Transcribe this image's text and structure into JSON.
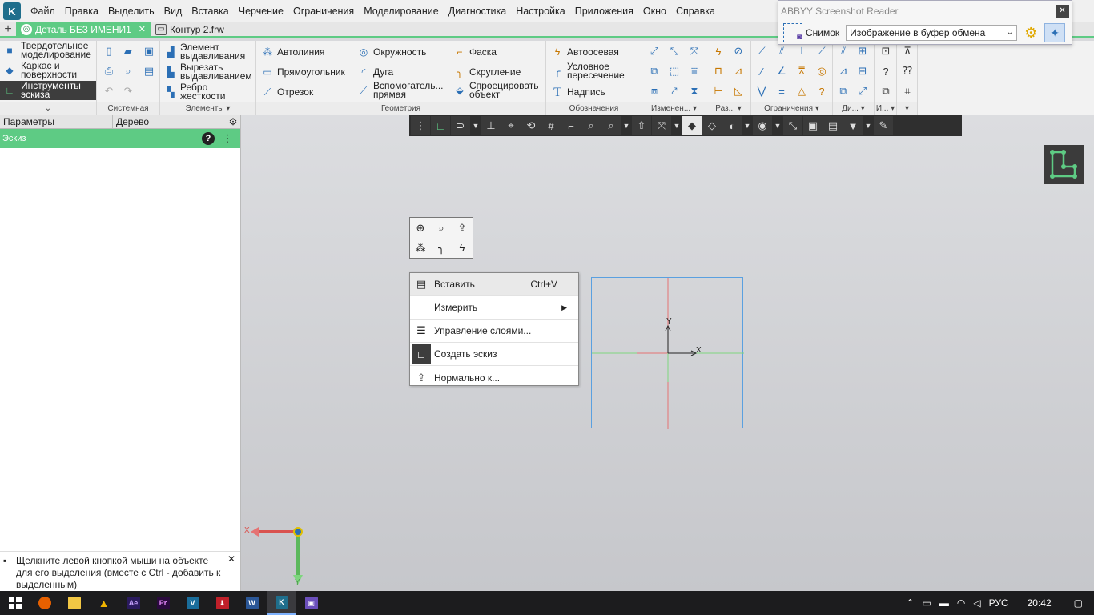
{
  "menu": [
    "Файл",
    "Правка",
    "Выделить",
    "Вид",
    "Вставка",
    "Черчение",
    "Ограничения",
    "Моделирование",
    "Диагностика",
    "Настройка",
    "Приложения",
    "Окно",
    "Справка"
  ],
  "tabs": [
    {
      "label": "Деталь БЕЗ ИМЕНИ1",
      "active": true
    },
    {
      "label": "Контур 2.frw",
      "active": false
    }
  ],
  "ribbon": {
    "modes": [
      "Твердотельное моделирование",
      "Каркас и поверхности",
      "Инструменты эскиза"
    ],
    "system_caption": "Системная",
    "elements": [
      "Элемент выдавливания",
      "Вырезать выдавливанием",
      "Ребро жесткости"
    ],
    "elements_caption": "Элементы",
    "geometry": {
      "col1": [
        "Автолиния",
        "Прямоугольник",
        "Отрезок"
      ],
      "col2": [
        "Окружность",
        "Дуга",
        "Вспомогатель... прямая"
      ],
      "col3": [
        "Фаска",
        "Скругление",
        "Спроецировать объект"
      ],
      "caption": "Геометрия"
    },
    "designations": [
      "Автоосевая",
      "Условное пересечение",
      "Надпись"
    ],
    "designations_caption": "Обозначения",
    "captions_small": [
      "Изменен...",
      "Раз...",
      "Ограничения",
      "Ди...",
      "И..."
    ]
  },
  "left_panel": {
    "tab_params": "Параметры",
    "tab_tree": "Дерево",
    "header": "Эскиз",
    "hint": "Щелкните левой кнопкой мыши на объекте для его выделения (вместе с Ctrl - добавить к выделенным)"
  },
  "context_menu": [
    {
      "label": "Вставить",
      "shortcut": "Ctrl+V",
      "icon": "paste-icon"
    },
    {
      "label": "Измерить",
      "shortcut": "",
      "icon": "",
      "submenu": true
    },
    {
      "label": "Управление слоями...",
      "shortcut": "",
      "icon": "layers-icon"
    },
    {
      "label": "Создать эскиз",
      "shortcut": "",
      "icon": "sketch-icon"
    },
    {
      "label": "Нормально к...",
      "shortcut": "",
      "icon": "normal-to-icon"
    }
  ],
  "axes": {
    "x": "X",
    "y": "Y"
  },
  "abbyy": {
    "title": "ABBYY Screenshot Reader",
    "snapshot_label": "Снимок",
    "target": "Изображение в буфер обмена"
  },
  "tray": {
    "lang": "РУС",
    "time": "20:42"
  },
  "colors": {
    "accent": "#5ecb84",
    "dark": "#3d3d3d",
    "sketch_box": "#5aa0e0"
  }
}
